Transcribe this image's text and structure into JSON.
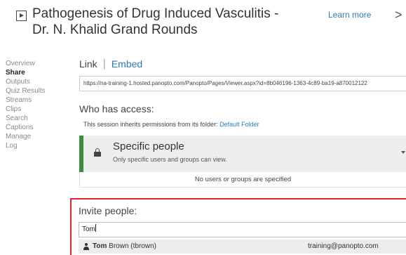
{
  "header": {
    "title": "Pathogenesis of Drug Induced Vasculitis - Dr. N. Khalid Grand Rounds",
    "learn_more": "Learn more",
    "close_glyph": ">",
    "icons": {
      "session": "play-icon",
      "close": "chevron-right-icon"
    }
  },
  "sidebar": {
    "items": [
      {
        "label": "Overview",
        "active": false
      },
      {
        "label": "Share",
        "active": true
      },
      {
        "label": "Outputs",
        "active": false
      },
      {
        "label": "Quiz Results",
        "active": false
      },
      {
        "label": "Streams",
        "active": false
      },
      {
        "label": "Clips",
        "active": false
      },
      {
        "label": "Search",
        "active": false
      },
      {
        "label": "Captions",
        "active": false
      },
      {
        "label": "Manage",
        "active": false
      },
      {
        "label": "Log",
        "active": false
      }
    ]
  },
  "share": {
    "tabs": {
      "link": "Link",
      "separator": "|",
      "embed": "Embed"
    },
    "url": "https://na-training-1.hosted.panopto.com/Panopto/Pages/Viewer.aspx?id=8b046196-1363-4c89-ba19-a870012122",
    "who_has_access": "Who has access:",
    "inherit_text": "This session inherits permissions from its folder:",
    "inherit_link": "Default Folder",
    "access": {
      "name": "Specific people",
      "description": "Only specific users and groups can view.",
      "icon": "lock-icon",
      "accent_color": "#3c8d3c"
    },
    "no_users": "No users or groups are specified"
  },
  "invite": {
    "label": "Invite people:",
    "input_value": "Tom",
    "highlight_color": "#e0262c",
    "suggestion": {
      "first": "Tom",
      "rest": "Brown (tbrown)",
      "email": "training@panopto.com",
      "icon": "user-icon"
    }
  },
  "colors": {
    "link": "#2a7ab8"
  }
}
